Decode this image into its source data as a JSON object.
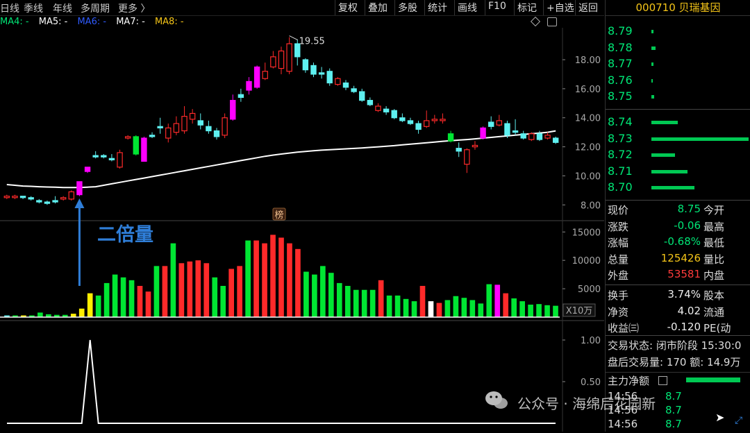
{
  "toolbar": {
    "tabs": [
      "日线",
      "季线",
      "年线",
      "多周期",
      "更多 〉"
    ],
    "buttons": [
      "复权",
      "叠加",
      "多股",
      "统计",
      "画线",
      "F10",
      "标记",
      "+自选",
      "返回"
    ]
  },
  "ma_legend": [
    {
      "label": "MA4: -",
      "color": "#00e676"
    },
    {
      "label": "MA5: -",
      "color": "#ffffff"
    },
    {
      "label": "MA6: -",
      "color": "#2f5bff"
    },
    {
      "label": "MA7: -",
      "color": "#ffffff"
    },
    {
      "label": "MA8: -",
      "color": "#f5c518"
    }
  ],
  "chart_data": [
    {
      "type": "candlestick",
      "yticks": [
        8.0,
        10.0,
        12.0,
        14.0,
        16.0,
        18.0
      ],
      "ylim": [
        7.2,
        20.2
      ],
      "high_annotation": "19.55",
      "badge": "榜",
      "candles": [
        {
          "o": 8.5,
          "c": 8.6,
          "h": 8.7,
          "l": 8.4,
          "col": "red"
        },
        {
          "o": 8.6,
          "c": 8.5,
          "h": 8.7,
          "l": 8.4,
          "col": "red"
        },
        {
          "o": 8.5,
          "c": 8.6,
          "h": 8.6,
          "l": 8.4,
          "col": "cyan"
        },
        {
          "o": 8.5,
          "c": 8.4,
          "h": 8.6,
          "l": 8.3,
          "col": "cyan"
        },
        {
          "o": 8.3,
          "c": 8.2,
          "h": 8.4,
          "l": 8.1,
          "col": "cyan"
        },
        {
          "o": 8.2,
          "c": 8.1,
          "h": 8.3,
          "l": 8.0,
          "col": "cyan"
        },
        {
          "o": 8.2,
          "c": 8.3,
          "h": 8.6,
          "l": 8.1,
          "col": "cyan"
        },
        {
          "o": 8.4,
          "c": 8.5,
          "h": 8.6,
          "l": 8.3,
          "col": "red"
        },
        {
          "o": 8.4,
          "c": 8.9,
          "h": 9.0,
          "l": 8.3,
          "col": "red"
        },
        {
          "o": 8.7,
          "c": 9.6,
          "h": 9.6,
          "l": 8.6,
          "col": "magenta"
        },
        {
          "o": 10.3,
          "c": 10.6,
          "h": 10.6,
          "l": 10.2,
          "col": "magenta"
        },
        {
          "o": 11.3,
          "c": 11.4,
          "h": 11.7,
          "l": 11.2,
          "col": "cyan"
        },
        {
          "o": 11.3,
          "c": 11.4,
          "h": 11.5,
          "l": 11.2,
          "col": "cyan"
        },
        {
          "o": 11.2,
          "c": 11.1,
          "h": 11.5,
          "l": 11.0,
          "col": "cyan"
        },
        {
          "o": 10.6,
          "c": 11.6,
          "h": 11.8,
          "l": 10.5,
          "col": "red"
        },
        {
          "o": 12.6,
          "c": 12.7,
          "h": 12.8,
          "l": 12.5,
          "col": "red"
        },
        {
          "o": 12.7,
          "c": 11.5,
          "h": 12.8,
          "l": 11.4,
          "col": "green"
        },
        {
          "o": 11.0,
          "c": 12.6,
          "h": 12.7,
          "l": 11.0,
          "col": "magenta"
        },
        {
          "o": 12.7,
          "c": 12.8,
          "h": 13.0,
          "l": 12.6,
          "col": "cyan"
        },
        {
          "o": 13.3,
          "c": 13.4,
          "h": 14.0,
          "l": 12.9,
          "col": "cyan"
        },
        {
          "o": 12.6,
          "c": 13.3,
          "h": 13.6,
          "l": 12.3,
          "col": "red"
        },
        {
          "o": 13.0,
          "c": 13.6,
          "h": 14.1,
          "l": 12.8,
          "col": "red"
        },
        {
          "o": 13.1,
          "c": 14.1,
          "h": 14.8,
          "l": 12.9,
          "col": "red"
        },
        {
          "o": 13.9,
          "c": 14.3,
          "h": 14.6,
          "l": 13.6,
          "col": "red"
        },
        {
          "o": 13.8,
          "c": 13.5,
          "h": 14.3,
          "l": 13.2,
          "col": "cyan"
        },
        {
          "o": 13.4,
          "c": 13.1,
          "h": 13.8,
          "l": 12.9,
          "col": "cyan"
        },
        {
          "o": 13.1,
          "c": 12.7,
          "h": 13.3,
          "l": 12.5,
          "col": "cyan"
        },
        {
          "o": 12.8,
          "c": 14.0,
          "h": 14.3,
          "l": 12.6,
          "col": "red"
        },
        {
          "o": 13.9,
          "c": 15.2,
          "h": 15.6,
          "l": 13.8,
          "col": "magenta"
        },
        {
          "o": 15.6,
          "c": 15.4,
          "h": 16.0,
          "l": 15.1,
          "col": "cyan"
        },
        {
          "o": 15.9,
          "c": 16.5,
          "h": 16.8,
          "l": 15.6,
          "col": "magenta"
        },
        {
          "o": 16.1,
          "c": 17.5,
          "h": 17.6,
          "l": 16.0,
          "col": "magenta"
        },
        {
          "o": 16.7,
          "c": 17.2,
          "h": 17.8,
          "l": 16.6,
          "col": "red"
        },
        {
          "o": 17.5,
          "c": 18.2,
          "h": 18.6,
          "l": 17.4,
          "col": "red"
        },
        {
          "o": 17.4,
          "c": 18.6,
          "h": 18.9,
          "l": 17.0,
          "col": "red"
        },
        {
          "o": 17.2,
          "c": 19.1,
          "h": 19.55,
          "l": 17.0,
          "col": "red"
        },
        {
          "o": 19.1,
          "c": 18.2,
          "h": 19.4,
          "l": 17.6,
          "col": "cyan"
        },
        {
          "o": 18.0,
          "c": 17.3,
          "h": 18.1,
          "l": 17.1,
          "col": "cyan"
        },
        {
          "o": 17.0,
          "c": 17.6,
          "h": 17.8,
          "l": 16.8,
          "col": "cyan"
        },
        {
          "o": 17.0,
          "c": 17.1,
          "h": 17.5,
          "l": 16.7,
          "col": "cyan"
        },
        {
          "o": 17.2,
          "c": 16.4,
          "h": 17.4,
          "l": 16.2,
          "col": "cyan"
        },
        {
          "o": 16.7,
          "c": 16.3,
          "h": 16.8,
          "l": 16.2,
          "col": "red"
        },
        {
          "o": 16.4,
          "c": 16.1,
          "h": 16.6,
          "l": 15.9,
          "col": "cyan"
        },
        {
          "o": 16.0,
          "c": 15.8,
          "h": 16.2,
          "l": 15.7,
          "col": "cyan"
        },
        {
          "o": 15.8,
          "c": 15.2,
          "h": 16.0,
          "l": 15.1,
          "col": "cyan"
        },
        {
          "o": 15.2,
          "c": 14.9,
          "h": 15.4,
          "l": 14.8,
          "col": "cyan"
        },
        {
          "o": 14.8,
          "c": 14.5,
          "h": 15.0,
          "l": 14.4,
          "col": "red"
        },
        {
          "o": 14.6,
          "c": 14.4,
          "h": 14.8,
          "l": 14.2,
          "col": "cyan"
        },
        {
          "o": 14.5,
          "c": 14.0,
          "h": 14.6,
          "l": 13.9,
          "col": "cyan"
        },
        {
          "o": 14.0,
          "c": 13.8,
          "h": 14.3,
          "l": 13.7,
          "col": "cyan"
        },
        {
          "o": 13.8,
          "c": 13.6,
          "h": 14.0,
          "l": 13.5,
          "col": "cyan"
        },
        {
          "o": 13.6,
          "c": 13.2,
          "h": 13.8,
          "l": 12.9,
          "col": "cyan"
        },
        {
          "o": 13.4,
          "c": 13.8,
          "h": 14.5,
          "l": 13.3,
          "col": "red"
        },
        {
          "o": 13.8,
          "c": 13.9,
          "h": 14.2,
          "l": 13.6,
          "col": "red"
        },
        {
          "o": 13.9,
          "c": 13.8,
          "h": 14.3,
          "l": 13.6,
          "col": "red"
        },
        {
          "o": 12.9,
          "c": 12.4,
          "h": 13.1,
          "l": 12.3,
          "col": "green"
        },
        {
          "o": 11.9,
          "c": 11.7,
          "h": 12.3,
          "l": 11.3,
          "col": "cyan"
        },
        {
          "o": 11.8,
          "c": 10.8,
          "h": 11.9,
          "l": 10.2,
          "col": "red"
        },
        {
          "o": 12.0,
          "c": 12.1,
          "h": 12.4,
          "l": 11.8,
          "col": "red"
        },
        {
          "o": 12.6,
          "c": 13.3,
          "h": 13.4,
          "l": 12.5,
          "col": "magenta"
        },
        {
          "o": 13.7,
          "c": 13.4,
          "h": 14.1,
          "l": 13.2,
          "col": "cyan"
        },
        {
          "o": 13.8,
          "c": 13.5,
          "h": 14.2,
          "l": 13.4,
          "col": "red"
        },
        {
          "o": 13.6,
          "c": 12.8,
          "h": 13.8,
          "l": 12.6,
          "col": "cyan"
        },
        {
          "o": 13.1,
          "c": 13.0,
          "h": 13.9,
          "l": 12.8,
          "col": "cyan"
        },
        {
          "o": 12.9,
          "c": 12.6,
          "h": 13.1,
          "l": 12.5,
          "col": "cyan"
        },
        {
          "o": 12.5,
          "c": 12.9,
          "h": 13.0,
          "l": 12.4,
          "col": "red"
        },
        {
          "o": 12.9,
          "c": 12.5,
          "h": 13.1,
          "l": 12.4,
          "col": "cyan"
        },
        {
          "o": 12.6,
          "c": 12.8,
          "h": 13.0,
          "l": 12.5,
          "col": "red"
        },
        {
          "o": 12.6,
          "c": 12.3,
          "h": 12.7,
          "l": 12.2,
          "col": "cyan"
        }
      ],
      "ma_line": [
        9.4,
        9.35,
        9.3,
        9.28,
        9.25,
        9.23,
        9.22,
        9.2,
        9.2,
        9.2,
        9.22,
        9.25,
        9.35,
        9.45,
        9.55,
        9.65,
        9.75,
        9.85,
        9.95,
        10.05,
        10.15,
        10.25,
        10.35,
        10.45,
        10.55,
        10.65,
        10.75,
        10.85,
        10.95,
        11.05,
        11.15,
        11.25,
        11.35,
        11.43,
        11.5,
        11.57,
        11.63,
        11.68,
        11.73,
        11.77,
        11.8,
        11.83,
        11.86,
        11.89,
        11.92,
        11.96,
        12.0,
        12.04,
        12.08,
        12.13,
        12.18,
        12.23,
        12.28,
        12.33,
        12.38,
        12.42,
        12.46,
        12.5,
        12.55,
        12.6,
        12.65,
        12.7,
        12.75,
        12.8,
        12.85,
        12.9,
        12.95,
        13.0,
        13.1
      ]
    },
    {
      "type": "bar",
      "name": "volume",
      "yticks": [
        5000,
        10000,
        15000
      ],
      "ylim": [
        0,
        16500
      ],
      "unit": "X10万",
      "values": [
        300,
        300,
        300,
        300,
        800,
        500,
        400,
        400,
        600,
        1500,
        4200,
        3800,
        6000,
        7500,
        7000,
        6500,
        5500,
        4500,
        9000,
        9000,
        13000,
        9500,
        9800,
        10000,
        9500,
        7000,
        5500,
        8500,
        9000,
        13500,
        13500,
        13000,
        14500,
        14000,
        13000,
        12000,
        8000,
        7500,
        9000,
        7800,
        6000,
        5500,
        4800,
        4800,
        4800,
        6500,
        3800,
        3800,
        3200,
        2800,
        5500,
        2800,
        2500,
        3000,
        3700,
        3400,
        3000,
        2400,
        5800,
        5700,
        4200,
        3300,
        2800,
        2200,
        2300,
        2100,
        2000
      ],
      "colors": [
        "cyan",
        "green",
        "yellow",
        "green",
        "green",
        "green",
        "green",
        "green",
        "yellow",
        "yellow",
        "yellow",
        "green",
        "green",
        "green",
        "green",
        "green",
        "red",
        "red",
        "green",
        "red",
        "green",
        "red",
        "red",
        "red",
        "red",
        "green",
        "green",
        "red",
        "red",
        "green",
        "red",
        "red",
        "red",
        "red",
        "red",
        "red",
        "green",
        "green",
        "green",
        "green",
        "green",
        "green",
        "green",
        "green",
        "green",
        "red",
        "green",
        "green",
        "green",
        "green",
        "red",
        "white",
        "red",
        "green",
        "green",
        "green",
        "green",
        "green",
        "green",
        "magenta",
        "red",
        "green",
        "green",
        "green",
        "green",
        "green",
        "green"
      ]
    },
    {
      "type": "line",
      "name": "signal",
      "yticks": [
        0.5,
        1.0
      ],
      "ylim": [
        0,
        1.2
      ],
      "values": [
        0,
        0,
        0,
        0,
        0,
        0,
        0,
        0,
        0,
        0,
        1,
        0,
        0,
        0,
        0,
        0,
        0,
        0,
        0,
        0,
        0,
        0,
        0,
        0,
        0,
        0,
        0,
        0,
        0,
        0,
        0,
        0,
        0,
        0,
        0,
        0,
        0,
        0,
        0,
        0,
        0,
        0,
        0,
        0,
        0,
        0,
        0,
        0,
        0,
        0,
        0,
        0,
        0,
        0,
        0,
        0,
        0,
        0,
        0,
        0,
        0,
        0,
        0,
        0,
        0,
        0,
        0
      ]
    }
  ],
  "annotation": "二倍量",
  "panel": {
    "title": "000710 贝瑞基因",
    "asks": [
      {
        "price": "8.79",
        "vol": 3
      },
      {
        "price": "8.78",
        "vol": 6
      },
      {
        "price": "8.77",
        "vol": 3
      },
      {
        "price": "8.76",
        "vol": 2
      },
      {
        "price": "8.75",
        "vol": 4
      }
    ],
    "bids": [
      {
        "price": "8.74",
        "vol": 38
      },
      {
        "price": "8.73",
        "vol": 140
      },
      {
        "price": "8.72",
        "vol": 34
      },
      {
        "price": "8.71",
        "vol": 52
      },
      {
        "price": "8.70",
        "vol": 62
      }
    ],
    "quotes": [
      {
        "label": "现价",
        "value": "8.75",
        "color": "green",
        "right": "今开"
      },
      {
        "label": "涨跌",
        "value": "-0.06",
        "color": "green",
        "right": "最高"
      },
      {
        "label": "涨幅",
        "value": "-0.68%",
        "color": "green",
        "right": "最低"
      },
      {
        "label": "总量",
        "value": "125426",
        "color": "yellow",
        "right": "量比"
      },
      {
        "label": "外盘",
        "value": "53581",
        "color": "red",
        "right": "内盘"
      },
      {
        "label": "换手",
        "value": "3.74%",
        "color": "white",
        "right": "股本"
      },
      {
        "label": "净资",
        "value": "4.02",
        "color": "white",
        "right": "流通"
      },
      {
        "label": "收益㈢",
        "value": "-0.120",
        "color": "white",
        "right": "PE(动"
      }
    ],
    "status_line": "交易状态: 闭市阶段 15:30:0",
    "after_hours": "盘后交易量: 170  额: 14.9万",
    "main_flow_label": "主力净额",
    "ticks": [
      {
        "time": "14:56",
        "price": "8.7"
      },
      {
        "time": "14:56",
        "price": "8.7"
      },
      {
        "time": "14:56",
        "price": "8.7"
      }
    ]
  },
  "watermark": "公众号 · 海绵后花园新"
}
